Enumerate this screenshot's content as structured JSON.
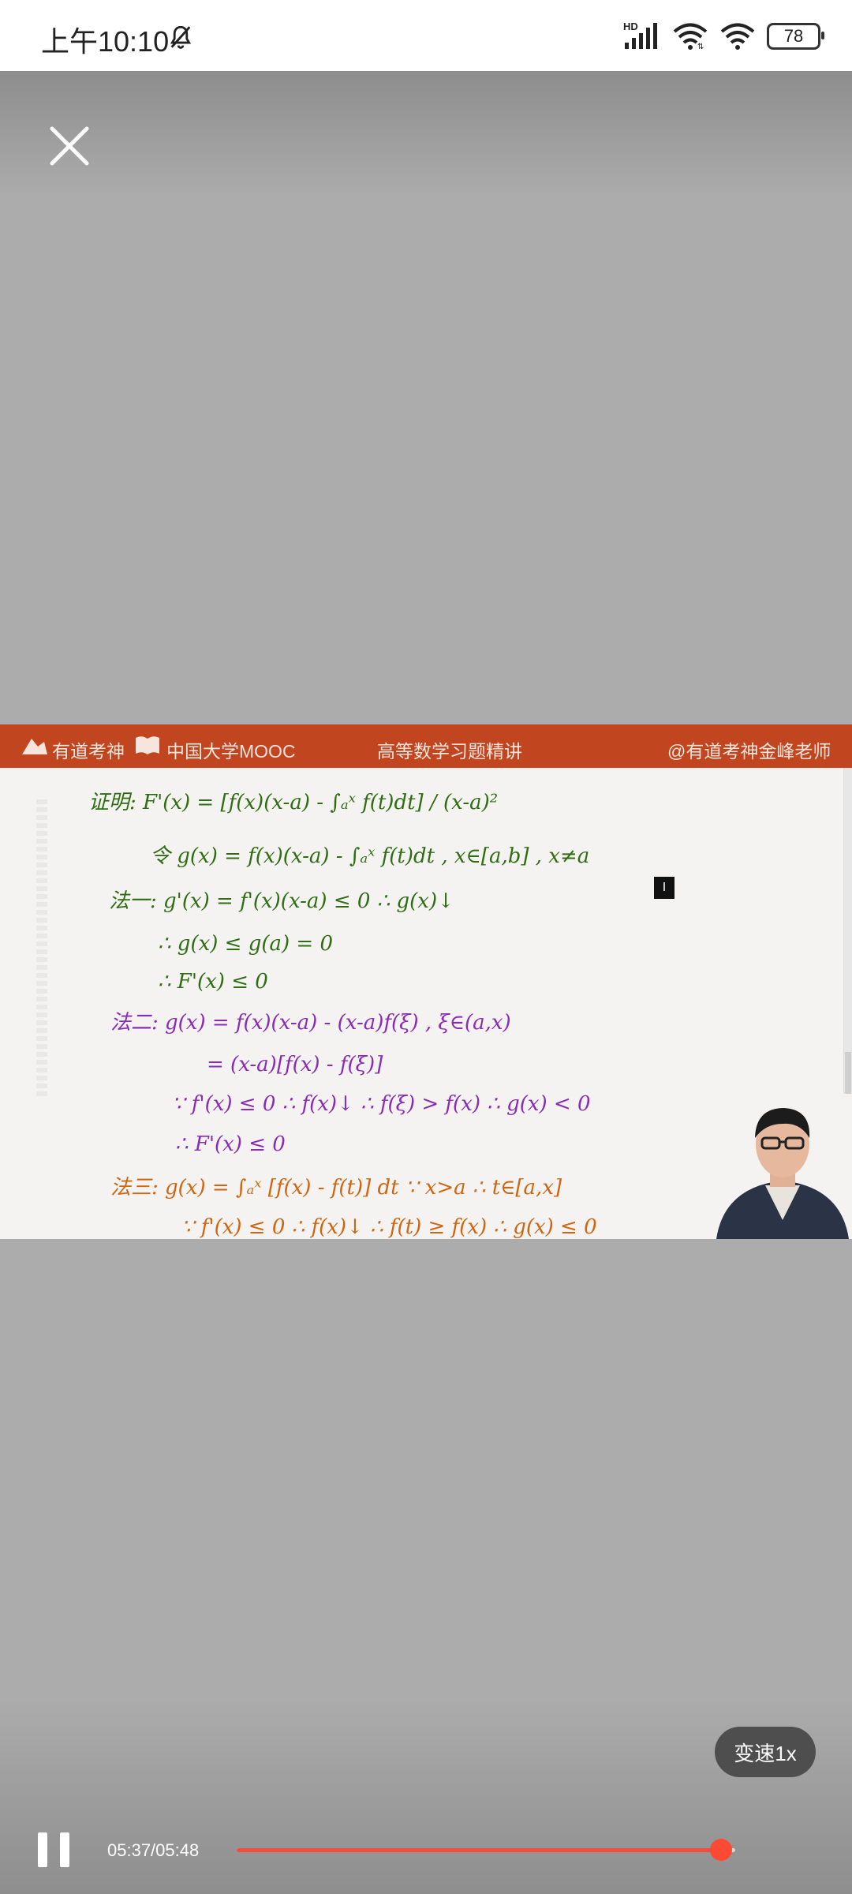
{
  "status_bar": {
    "time": "上午10:10",
    "network_badge": "HD",
    "battery": "78"
  },
  "video": {
    "banner": {
      "brand": "有道考神",
      "platform": "中国大学MOOC",
      "course_title": "高等数学习题精讲",
      "teacher_handle": "@有道考神金峰老师"
    },
    "board_lines": [
      "证明: F'(x) = [f(x)(x-a) - ∫ₐˣ f(t)dt] / (x-a)²",
      "令 g(x) = f(x)(x-a) - ∫ₐˣ f(t)dt , x∈[a,b] , x≠a",
      "法一: g'(x) = f'(x)(x-a) ≤ 0  ∴ g(x)↓",
      "∴ g(x) ≤ g(a) = 0",
      "∴ F'(x) ≤ 0",
      "法二: g(x) = f(x)(x-a) - (x-a)f(ξ) , ξ∈(a,x)",
      "= (x-a)[f(x) - f(ξ)]",
      "∵ f'(x) ≤ 0 ∴ f(x)↓  ∴ f(ξ) > f(x)  ∴ g(x) < 0",
      "∴ F'(x) ≤ 0",
      "法三: g(x) = ∫ₐˣ [f(x) - f(t)] dt   ∵ x>a ∴ t∈[a,x]",
      "∵ f'(x) ≤ 0 ∴ f(x)↓  ∴ f(t) ≥ f(x)  ∴ g(x) ≤ 0"
    ]
  },
  "controls": {
    "speed_label": "变速1x",
    "time_display": "05:37/05:48",
    "progress_fraction": 0.9709
  },
  "icons": {
    "close": "close-icon",
    "pause": "pause-icon",
    "mute": "bell-off-icon",
    "wifi": "wifi-icon",
    "signal": "signal-icon"
  },
  "colors": {
    "banner": "#c1451f",
    "progress": "#f14d3a",
    "ink_green": "#2f6d12",
    "ink_purple": "#8a2bb5",
    "ink_orange": "#d0650f"
  }
}
